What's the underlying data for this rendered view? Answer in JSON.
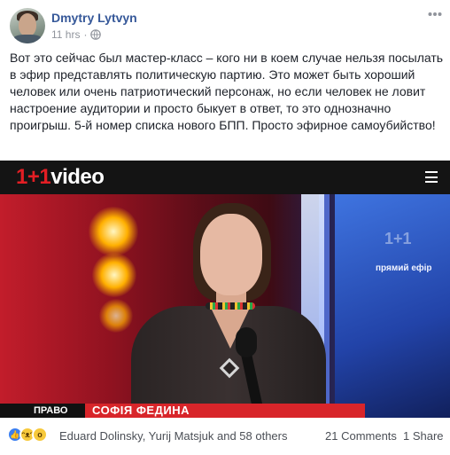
{
  "post": {
    "author": "Dmytry Lytvyn",
    "time": "11 hrs",
    "separator": "·",
    "text": "Вот это сейчас был мастер-класс – кого ни в коем случае нельзя посылать в эфир представлять политическую партию. Это может быть хороший человек или очень патриотический персонаж, но если человек не ловит настроение аудитории и просто быкует в ответ, то это однозначно проигрыш. 5-й номер списка нового БПП. Просто эфирное самоубийство!",
    "privacy_icon": "globe-icon",
    "menu_icon": "more-icon"
  },
  "video": {
    "brand_plus": "1+1",
    "brand_rest": "video",
    "live_label": "прямий ефір",
    "show_name": "ПРАВО",
    "caption_name": "СОФІЯ ФЕДИНА",
    "menu_icon": "hamburger-icon"
  },
  "footer": {
    "reactions": [
      "like-icon",
      "haha-icon",
      "wow-icon"
    ],
    "reactors": "Eduard Dolinsky, Yurij Matsjuk and 58 others",
    "comments": "21 Comments",
    "shares": "1 Share"
  },
  "colors": {
    "link_blue": "#365899",
    "meta_grey": "#90949c",
    "caption_red": "#d8252a",
    "like_blue": "#3b7ff0"
  }
}
